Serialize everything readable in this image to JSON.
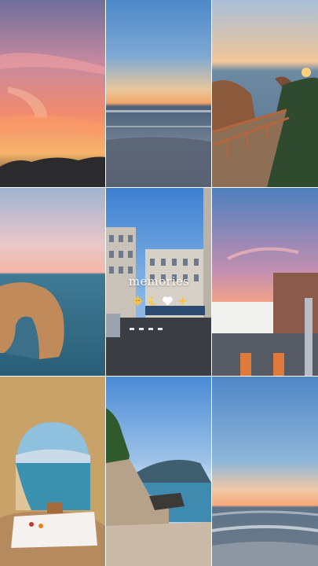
{
  "caption": {
    "text": "memories",
    "emojis": [
      "sun-with-face-icon",
      "sparkle-moon-icon",
      "white-heart-icon",
      "sparkles-icon"
    ]
  },
  "colors": {
    "caption_text": "#ffffff",
    "sunset_pink": "#f08a8a",
    "ocean_blue": "#3f6f8f",
    "sky_blue": "#4f86c6"
  },
  "tiles": [
    {
      "id": "sunset-clouds"
    },
    {
      "id": "beach-sunset"
    },
    {
      "id": "coastal-boardwalk"
    },
    {
      "id": "sea-arch-rock"
    },
    {
      "id": "city-street"
    },
    {
      "id": "rooftops-sunset"
    },
    {
      "id": "cave-picnic"
    },
    {
      "id": "rocky-cove"
    },
    {
      "id": "ocean-dusk"
    }
  ]
}
